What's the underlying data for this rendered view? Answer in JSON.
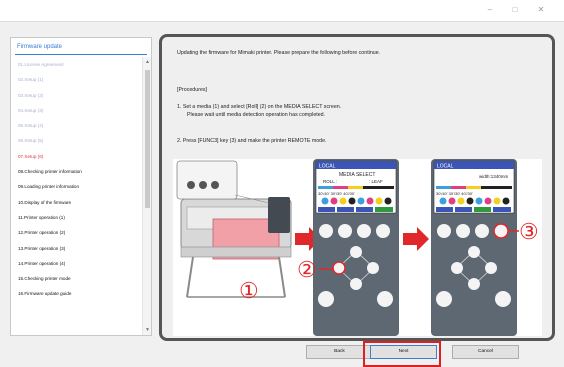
{
  "window": {
    "minimize_glyph": "–",
    "maximize_glyph": "□",
    "close_glyph": "✕"
  },
  "sidebar": {
    "title": "Firmware update",
    "items": [
      {
        "label": "01.License Agreement",
        "state": "done"
      },
      {
        "label": "02.Setup (1)",
        "state": "done"
      },
      {
        "label": "03.Setup (2)",
        "state": "done"
      },
      {
        "label": "04.Setup (3)",
        "state": "done"
      },
      {
        "label": "05.Setup (4)",
        "state": "done"
      },
      {
        "label": "06.Setup (5)",
        "state": "done"
      },
      {
        "label": "07.Setup (6)",
        "state": "current"
      },
      {
        "label": "08.Checking printer information",
        "state": "todo"
      },
      {
        "label": "09.Loading printer information",
        "state": "todo"
      },
      {
        "label": "10.Display of the firmware",
        "state": "todo"
      },
      {
        "label": "11.Printer operation (1)",
        "state": "todo"
      },
      {
        "label": "12.Printer operation (2)",
        "state": "todo"
      },
      {
        "label": "13.Printer operation (3)",
        "state": "todo"
      },
      {
        "label": "14.Printer operation (4)",
        "state": "todo"
      },
      {
        "label": "15.Checking printer mode",
        "state": "todo"
      },
      {
        "label": "16.Firmware update guide",
        "state": "todo"
      }
    ]
  },
  "content": {
    "intro": "Updating the firmware for Mimaki printer. Please prepare the following before continue.",
    "procedures_heading": "[Procedures]",
    "step1_line1": "1.  Set a media (1) and select [Roll] (2) on the MEDIA SELECT screen.",
    "step1_line2": "Please wait until media detection operation has completed.",
    "step2": "2.  Press [FUNC3] key (3) and make the printer REMOTE mode."
  },
  "illustration": {
    "panel1": {
      "mode": "LOCAL",
      "screen_title": "MEDIA SELECT",
      "option_left": "ROLL :",
      "option_right": ": LEAF",
      "ink_values": "30'/40'  30'/30'  40'/30'"
    },
    "panel2": {
      "mode": "LOCAL",
      "width_text": "width:1340mm",
      "ink_values": "30'/40'  30'/30'  40'/30'"
    },
    "callouts": [
      "①",
      "②",
      "③"
    ],
    "colors": {
      "callout_red": "#e0282a",
      "panel_gray": "#5e6872",
      "screen_blue": "#3b55b6",
      "remote_green": "#2e9a3c"
    }
  },
  "buttons": {
    "back": "Back",
    "next": "Next",
    "cancel": "Cancel"
  }
}
